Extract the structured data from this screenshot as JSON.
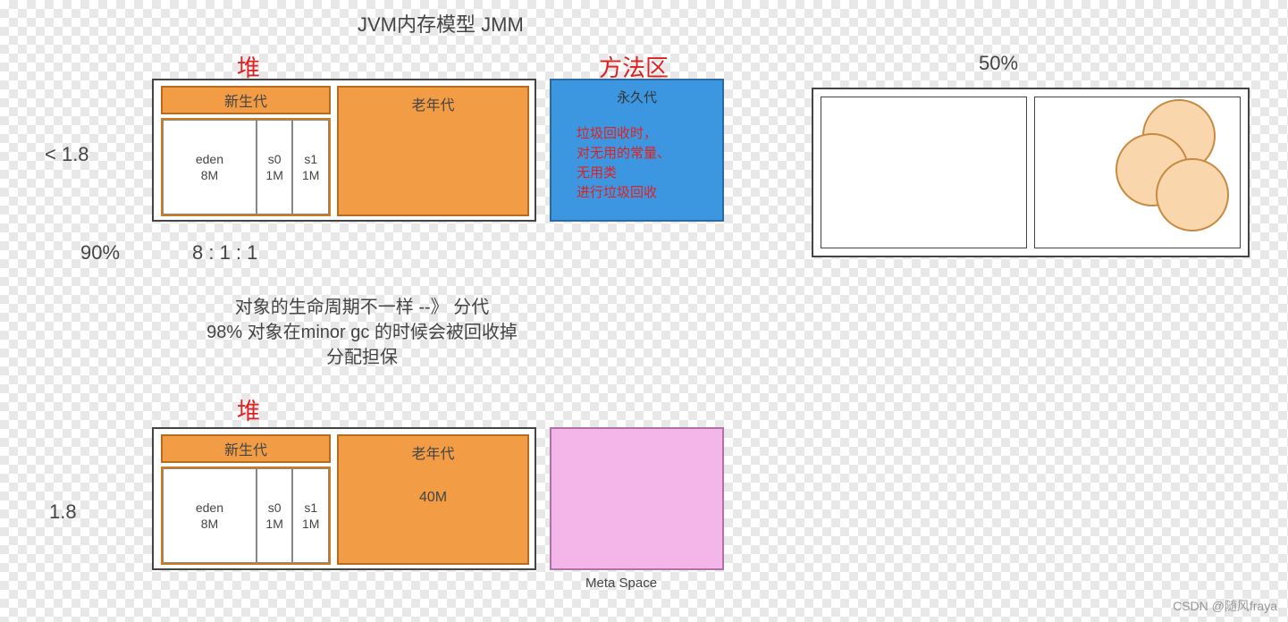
{
  "title": "JVM内存模型 JMM",
  "labels": {
    "heap1": "堆",
    "methodArea": "方法区",
    "fifty": "50%",
    "lt18": "< 1.8",
    "ninety": "90%",
    "ratio": "8 : 1 : 1",
    "heap2": "堆",
    "v18": "1.8",
    "metaSpace": "Meta Space"
  },
  "notes": {
    "line1": "对象的生命周期不一样 --》 分代",
    "line2": "98% 对象在minor gc 的时候会被回收掉",
    "line3": "分配担保"
  },
  "heap1": {
    "youngHeader": "新生代",
    "old": "老年代",
    "edenName": "eden",
    "edenSize": "8M",
    "s0Name": "s0",
    "s0Size": "1M",
    "s1Name": "s1",
    "s1Size": "1M"
  },
  "heap2": {
    "youngHeader": "新生代",
    "old": "老年代",
    "oldSize": "40M",
    "edenName": "eden",
    "edenSize": "8M",
    "s0Name": "s0",
    "s0Size": "1M",
    "s1Name": "s1",
    "s1Size": "1M"
  },
  "perm": {
    "title": "永久代",
    "note1": "垃圾回收时，",
    "note2": "对无用的常量、",
    "note3": "无用类",
    "note4": "进行垃圾回收"
  },
  "watermark": "CSDN @随风fraya"
}
